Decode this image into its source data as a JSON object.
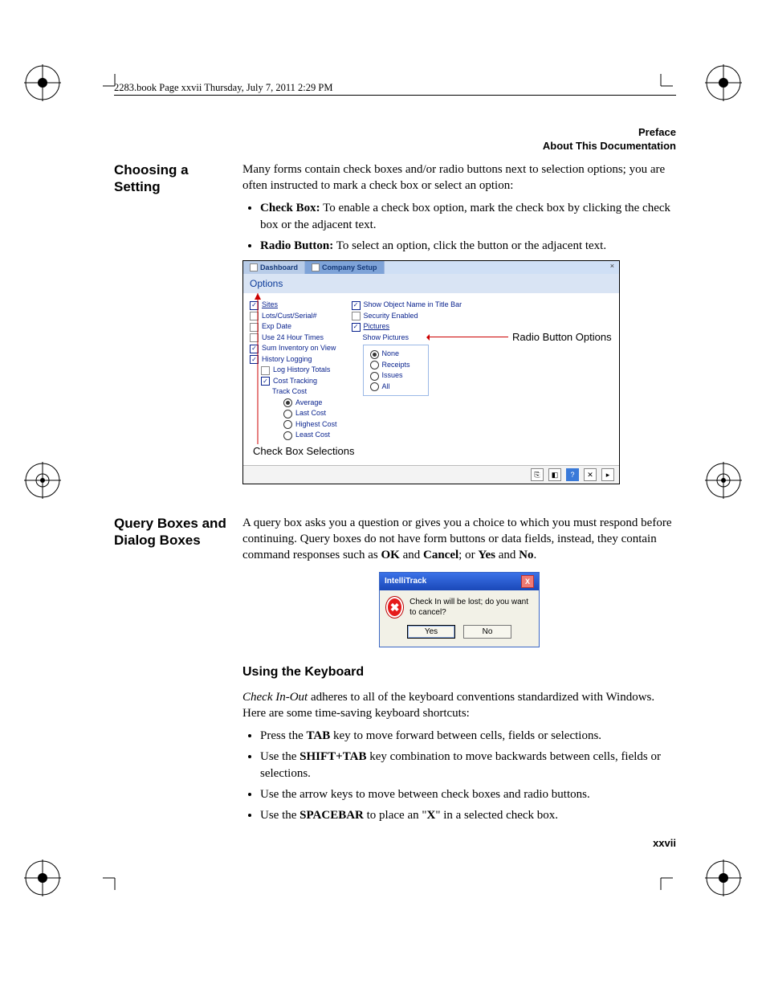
{
  "header": {
    "bookline": "2283.book  Page xxvii  Thursday, July 7, 2011  2:29 PM",
    "preface": "Preface",
    "about": "About This Documentation"
  },
  "section1": {
    "title": "Choosing a Setting",
    "para": "Many forms contain check boxes and/or radio buttons next to selection options; you are often instructed to mark a check box or select an option:",
    "bullets": {
      "cb_label": "Check Box:",
      "cb_text": " To enable a check box option, mark the check box by clicking the check box or the adjacent text.",
      "rb_label": "Radio Button:",
      "rb_text": " To select an option, click the button or the adjacent text."
    }
  },
  "illus1": {
    "tab_dashboard": "Dashboard",
    "tab_company": "Company Setup",
    "options_title": "Options",
    "left": {
      "sites": "Sites",
      "lots": "Lots/Cust/Serial#",
      "exp": "Exp Date",
      "use24": "Use 24 Hour Times",
      "suminv": "Sum Inventory on View",
      "histlog": "History Logging",
      "loghist": "Log History Totals",
      "costtrk": "Cost Tracking",
      "trackcost": "Track Cost",
      "avg": "Average",
      "last": "Last Cost",
      "high": "Highest Cost",
      "least": "Least Cost"
    },
    "right": {
      "showobj": "Show Object Name in Title Bar",
      "sec": "Security Enabled",
      "pics": "Pictures",
      "showpics": "Show Pictures",
      "none": "None",
      "receipts": "Receipts",
      "issues": "Issues",
      "all": "All"
    },
    "callout_radio": "Radio Button Options",
    "callout_cb": "Check Box Selections"
  },
  "section2": {
    "title": "Query Boxes and Dialog Boxes",
    "para_a": "A query box asks you a question or gives you a choice to which you must respond before continuing. Query boxes do not have form buttons or data fields, instead, they contain command responses such as ",
    "ok": "OK",
    "and1": " and ",
    "cancel": "Cancel",
    "semi": "; or ",
    "yes": "Yes",
    "and2": " and ",
    "no": "No",
    "period": "."
  },
  "dialog": {
    "title": "IntelliTrack",
    "msg": "Check In will be lost; do you want to cancel?",
    "yes": "Yes",
    "no": "No"
  },
  "section3": {
    "title": "Using the Keyboard",
    "para_a": "Check In-Out",
    "para_b": " adheres to all of the keyboard conventions standardized with Windows. Here are some time-saving keyboard shortcuts:",
    "b1_a": "Press the ",
    "b1_tab": "TAB",
    "b1_b": " key to move forward between cells, fields or selections.",
    "b2_a": "Use the ",
    "b2_st": "SHIFT+TAB",
    "b2_b": " key combination to move backwards between cells, fields or selections.",
    "b3": "Use the arrow keys to move between check boxes and radio buttons.",
    "b4_a": "Use the ",
    "b4_sp": "SPACEBAR",
    "b4_b": " to place an \"",
    "b4_x": "X",
    "b4_c": "\" in a selected check box."
  },
  "footer": {
    "pageno": "xxvii"
  }
}
